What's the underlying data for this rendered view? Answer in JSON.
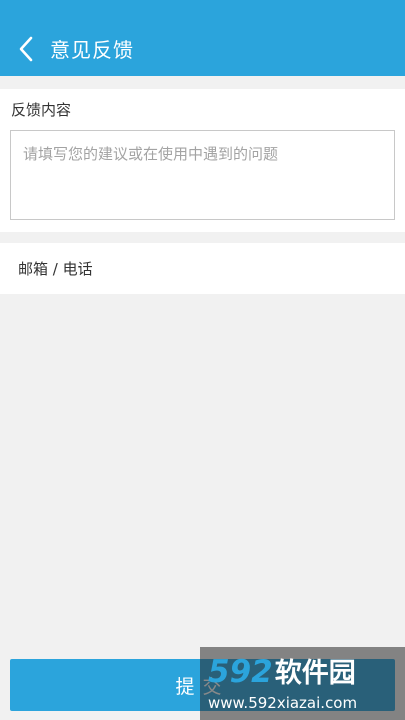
{
  "header": {
    "title": "意见反馈",
    "back_icon": "chevron-left-icon",
    "background": "#2ba4dc"
  },
  "feedback": {
    "label": "反馈内容",
    "placeholder": "请填写您的建议或在使用中遇到的问题",
    "value": ""
  },
  "contact": {
    "placeholder": "邮箱 / 电话",
    "value": ""
  },
  "submit": {
    "label": "提交",
    "background": "#2ba4dc"
  },
  "watermark": {
    "logo_number": "592",
    "logo_text": "软件园",
    "url": "www.592xiazai.com"
  }
}
